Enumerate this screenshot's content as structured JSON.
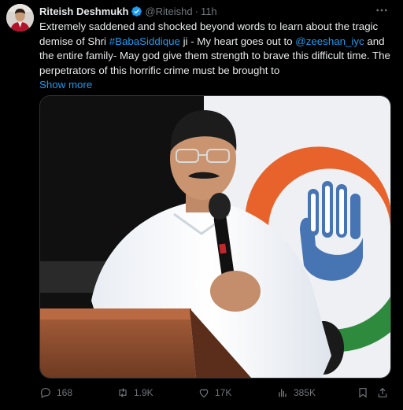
{
  "author": {
    "name": "Riteish Deshmukh",
    "handle": "@Riteishd",
    "separator": "·",
    "time": "11h"
  },
  "tweet": {
    "part1": "Extremely saddened and shocked beyond words to learn about the tragic demise of Shri ",
    "hashtag": "#BabaSiddique",
    "part2": " ji - My heart goes out to ",
    "mention": "@zeeshan_iyc",
    "part3": " and the entire family- May god give them strength to brave this difficult time. The perpetrators of this horrific crime must be brought to",
    "show_more": "Show more"
  },
  "actions": {
    "replies": "168",
    "reposts": "1.9K",
    "likes": "17K",
    "views": "385K"
  },
  "colors": {
    "background": "#000000",
    "text": "#e7e9ea",
    "muted": "#71767b",
    "accent": "#1d9bf0"
  },
  "icons": [
    "verified-badge-icon",
    "more-options-icon",
    "reply-icon",
    "repost-icon",
    "like-icon",
    "views-icon",
    "bookmark-icon",
    "share-icon"
  ]
}
